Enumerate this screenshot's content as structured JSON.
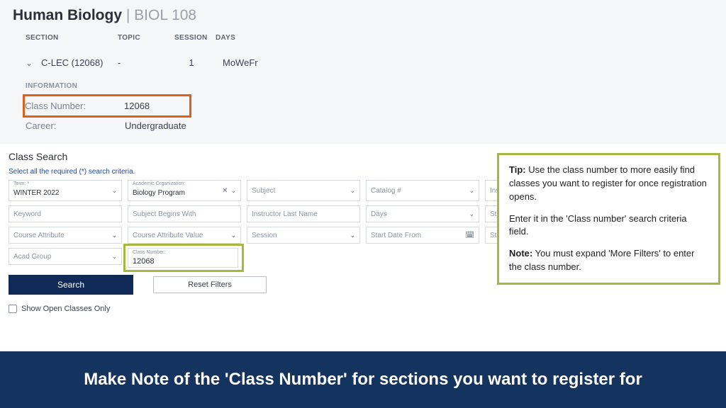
{
  "course": {
    "title": "Human Biology",
    "code": "BIOL 108"
  },
  "table": {
    "headers": {
      "section": "SECTION",
      "topic": "TOPIC",
      "session": "SESSION",
      "days": "DAYS"
    },
    "row": {
      "section": "C-LEC (12068)",
      "topic": "-",
      "session": "1",
      "days": "MoWeFr"
    }
  },
  "info": {
    "heading": "INFORMATION",
    "class_number_label": "Class Number:",
    "class_number_value": "12068",
    "career_label": "Career:",
    "career_value": "Undergraduate"
  },
  "search": {
    "title": "Class Search",
    "req_note": "Select all the required (*) search criteria.",
    "term_label": "Term: *",
    "term_value": "WINTER 2022",
    "acad_org_label": "Academic Organization:",
    "acad_org_value": "Biology Program",
    "subject_ph": "Subject",
    "catalog_ph": "Catalog #",
    "instructor_ph": "Instructo",
    "keyword_ph": "Keyword",
    "subj_begins_ph": "Subject Begins With",
    "instr_last_ph": "Instructor Last Name",
    "days_ph": "Days",
    "start_tim_ph": "Start Tim",
    "course_attr_ph": "Course Attribute",
    "course_attr_val_ph": "Course Attribute Value",
    "session_ph": "Session",
    "start_date_from_ph": "Start Date From",
    "start_dat_ph": "Start Dat",
    "acad_group_ph": "Acad Group",
    "class_num_label": "Class Number:",
    "class_num_value": "12068",
    "search_btn": "Search",
    "reset_btn": "Reset Filters",
    "open_only": "Show Open Classes Only"
  },
  "tip": {
    "bold1": "Tip:",
    "text1": " Use the class number to more easily find classes you want to register for once registration opens.",
    "text2": "Enter it in the 'Class number' search criteria field.",
    "bold2": "Note:",
    "text3": " You must expand 'More Filters' to enter the class number."
  },
  "banner": "Make Note of the 'Class Number' for sections you want to register for"
}
